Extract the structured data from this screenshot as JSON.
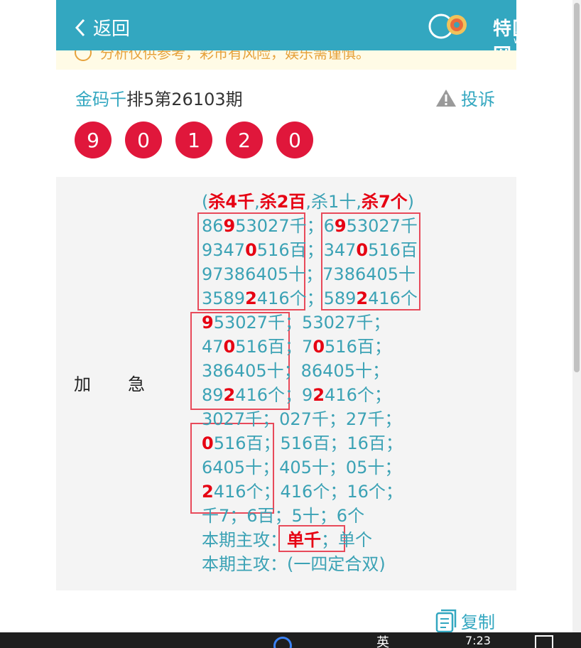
{
  "header": {
    "back_label": "返回",
    "logo_text": "特区彩票网",
    "logo_url": "www.tqcp.net"
  },
  "notice": {
    "text": "分析仅供参考，彩市有风险，娱乐需谨慎。"
  },
  "article": {
    "author": "金码千",
    "issue": "排5第26103期",
    "complain_label": "投诉"
  },
  "balls": [
    "9",
    "0",
    "1",
    "2",
    "0"
  ],
  "panel": {
    "label": "加急",
    "lines": [
      [
        {
          "t": "(",
          "h": false
        },
        {
          "t": "杀4千",
          "h": true
        },
        {
          "t": ",",
          "h": false
        },
        {
          "t": "杀2百",
          "h": true
        },
        {
          "t": ",杀1十,",
          "h": false
        },
        {
          "t": "杀7个",
          "h": true
        },
        {
          "t": ")",
          "h": false
        }
      ],
      [
        {
          "t": "86",
          "h": false
        },
        {
          "t": "9",
          "h": true
        },
        {
          "t": "53027千；6",
          "h": false
        },
        {
          "t": "9",
          "h": true
        },
        {
          "t": "53027千",
          "h": false
        }
      ],
      [
        {
          "t": "9347",
          "h": false
        },
        {
          "t": "0",
          "h": true
        },
        {
          "t": "516百；347",
          "h": false
        },
        {
          "t": "0",
          "h": true
        },
        {
          "t": "516百",
          "h": false
        }
      ],
      [
        {
          "t": "97386405十；7386405十",
          "h": false
        }
      ],
      [
        {
          "t": "3589",
          "h": false
        },
        {
          "t": "2",
          "h": true
        },
        {
          "t": "416个；589",
          "h": false
        },
        {
          "t": "2",
          "h": true
        },
        {
          "t": "416个",
          "h": false
        }
      ],
      [
        {
          "t": "9",
          "h": true
        },
        {
          "t": "53027千；53027千；",
          "h": false
        }
      ],
      [
        {
          "t": "47",
          "h": false
        },
        {
          "t": "0",
          "h": true
        },
        {
          "t": "516百；7",
          "h": false
        },
        {
          "t": "0",
          "h": true
        },
        {
          "t": "516百；",
          "h": false
        }
      ],
      [
        {
          "t": "386405十；86405十；",
          "h": false
        }
      ],
      [
        {
          "t": "89",
          "h": false
        },
        {
          "t": "2",
          "h": true
        },
        {
          "t": "416个；9",
          "h": false
        },
        {
          "t": "2",
          "h": true
        },
        {
          "t": "416个；",
          "h": false
        }
      ],
      [
        {
          "t": "3027千；027千；27千；",
          "h": false
        }
      ],
      [
        {
          "t": "0",
          "h": true
        },
        {
          "t": "516百；516百；16百；",
          "h": false
        }
      ],
      [
        {
          "t": "6405十；405十；05十；",
          "h": false
        }
      ],
      [
        {
          "t": "2",
          "h": true
        },
        {
          "t": "416个；416个；16个；",
          "h": false
        }
      ],
      [
        {
          "t": "千7；6百；5十；6个",
          "h": false
        }
      ],
      [
        {
          "t": "本期主攻：",
          "h": false
        },
        {
          "t": "单千",
          "h": true
        },
        {
          "t": "；单个",
          "h": false
        }
      ],
      [
        {
          "t": "本期主攻：(一四定合双)",
          "h": false
        }
      ]
    ]
  },
  "copy_label": "复制",
  "taskbar": {
    "time": "7:23",
    "ime": "英"
  },
  "colors": {
    "header_bg": "#33a7c0",
    "ball": "#e0173b",
    "text_accent": "#3ba2b5",
    "highlight": "#e60012"
  }
}
